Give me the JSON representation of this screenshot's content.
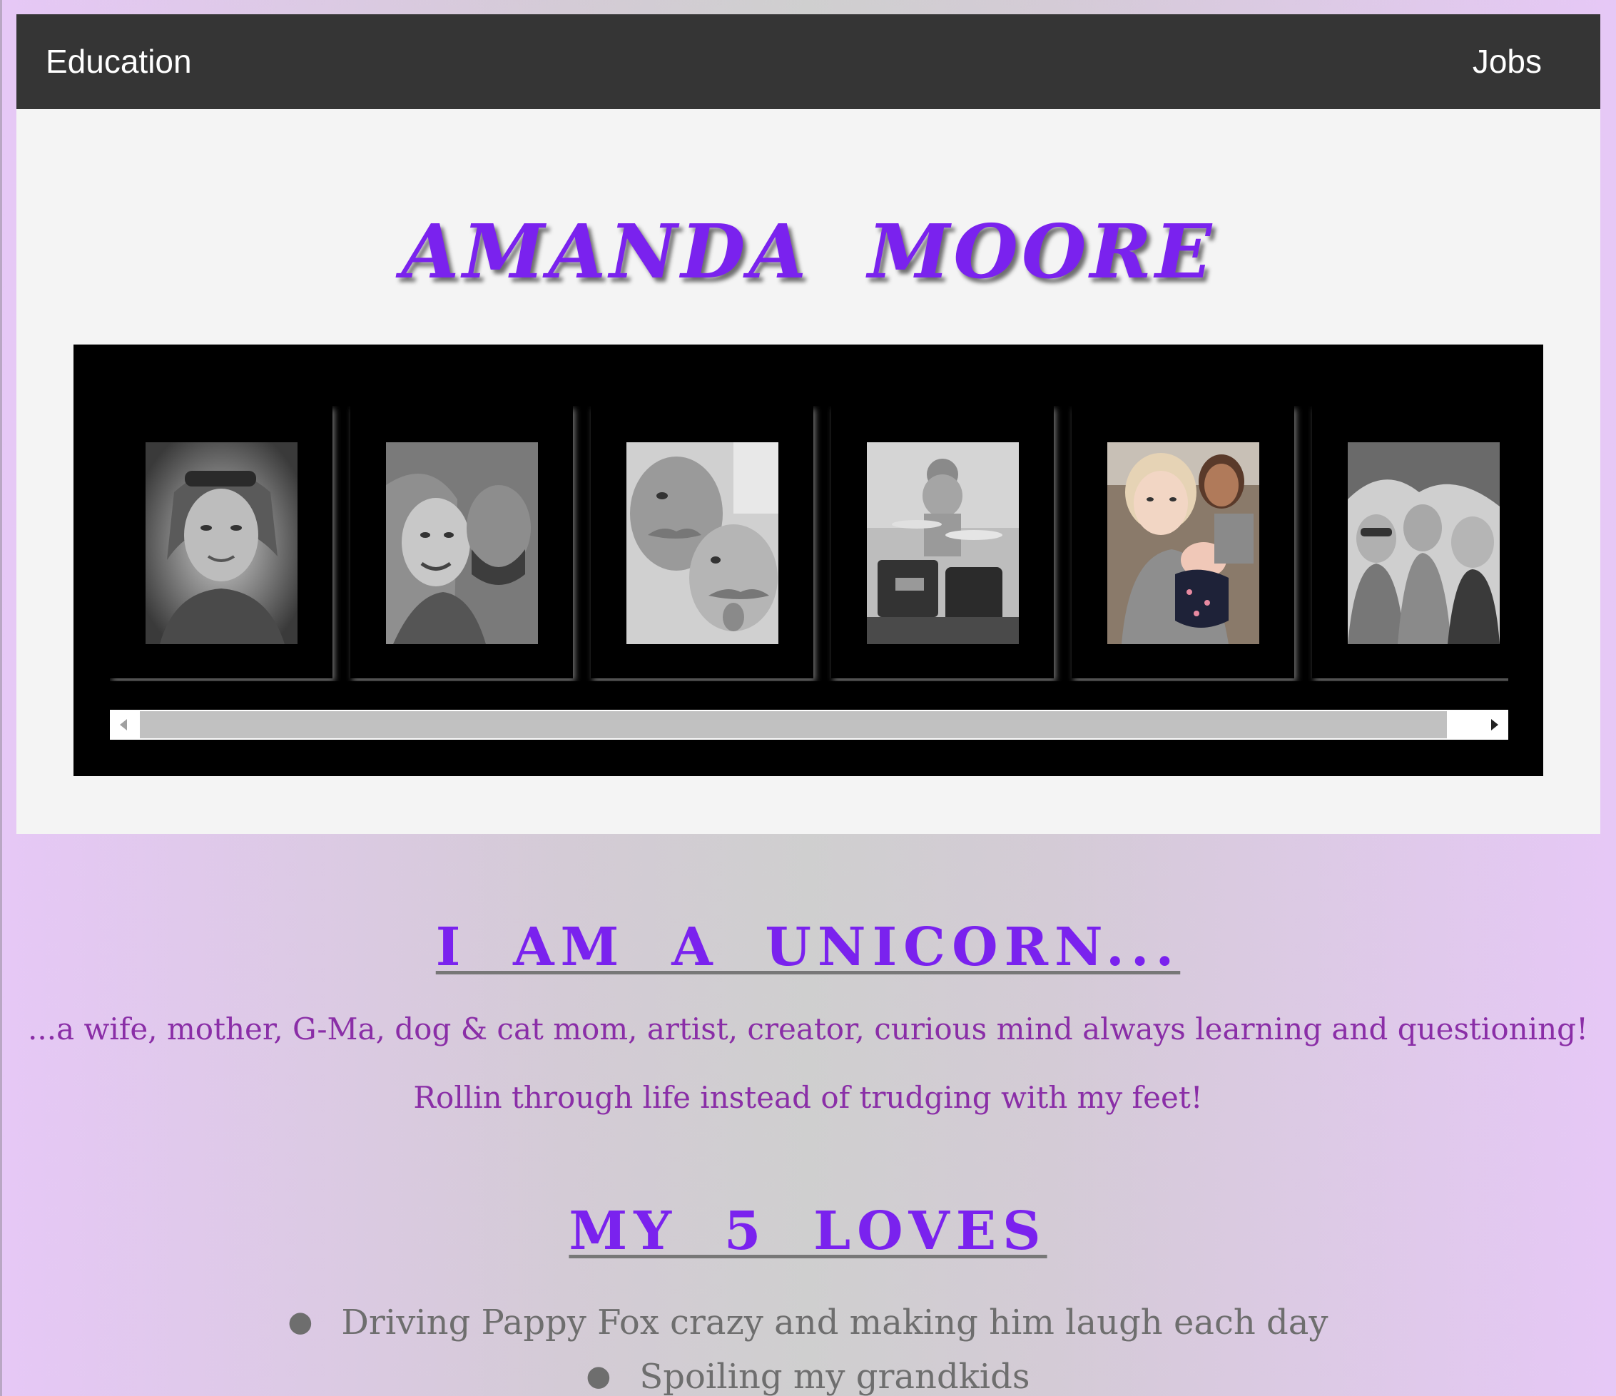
{
  "nav": {
    "education": "Education",
    "jobs": "Jobs"
  },
  "hero": {
    "title": "AMANDA MOORE"
  },
  "gallery": {
    "photos": [
      {
        "icon": "woman-smiling-portrait"
      },
      {
        "icon": "couple-selfie-portrait"
      },
      {
        "icon": "mustache-selfie-portrait"
      },
      {
        "icon": "child-drum-kit-photo"
      },
      {
        "icon": "kids-with-baby-photo"
      },
      {
        "icon": "three-girls-outdoors-photo"
      }
    ],
    "scrollbar": {
      "left_arrow": "scroll-left-arrow",
      "right_arrow": "scroll-right-arrow"
    }
  },
  "about": {
    "heading": "I AM A UNICORN...",
    "line1": "...a wife, mother, G-Ma, dog & cat mom, artist, creator, curious mind always learning and questioning!",
    "line2": "Rollin through life instead of trudging with my feet!"
  },
  "loves": {
    "heading": "MY 5 LOVES",
    "items": [
      "Driving Pappy Fox crazy and making him laugh each day",
      "Spoiling my grandkids"
    ]
  },
  "colors": {
    "accent": "#7a22ee",
    "text_purple": "#8a2ea7",
    "nav_bg": "#353535",
    "hero_bg": "#f4f4f4"
  }
}
